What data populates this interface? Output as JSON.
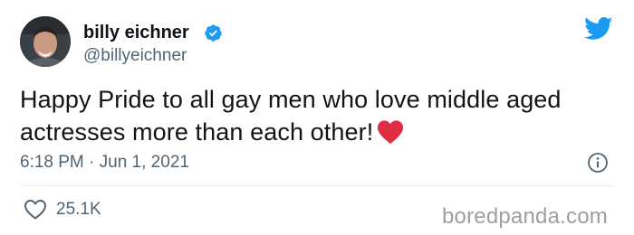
{
  "author": {
    "display_name": "billy eichner",
    "handle": "@billyeichner",
    "verified": true,
    "avatar_icon": "user-avatar"
  },
  "tweet": {
    "text": "Happy Pride to all gay men who love middle aged actresses more than each other!",
    "emoji": "red-heart",
    "timestamp": "6:18 PM · Jun 1, 2021",
    "likes": "25.1K"
  },
  "icons": {
    "brand": "twitter-bird-icon",
    "verified": "verified-badge-icon",
    "info": "info-icon",
    "like": "heart-outline-icon"
  },
  "colors": {
    "twitter_blue": "#1d9bf0",
    "emoji_red": "#dd2e44",
    "secondary_text": "#536471"
  },
  "watermark": "boredpanda.com"
}
